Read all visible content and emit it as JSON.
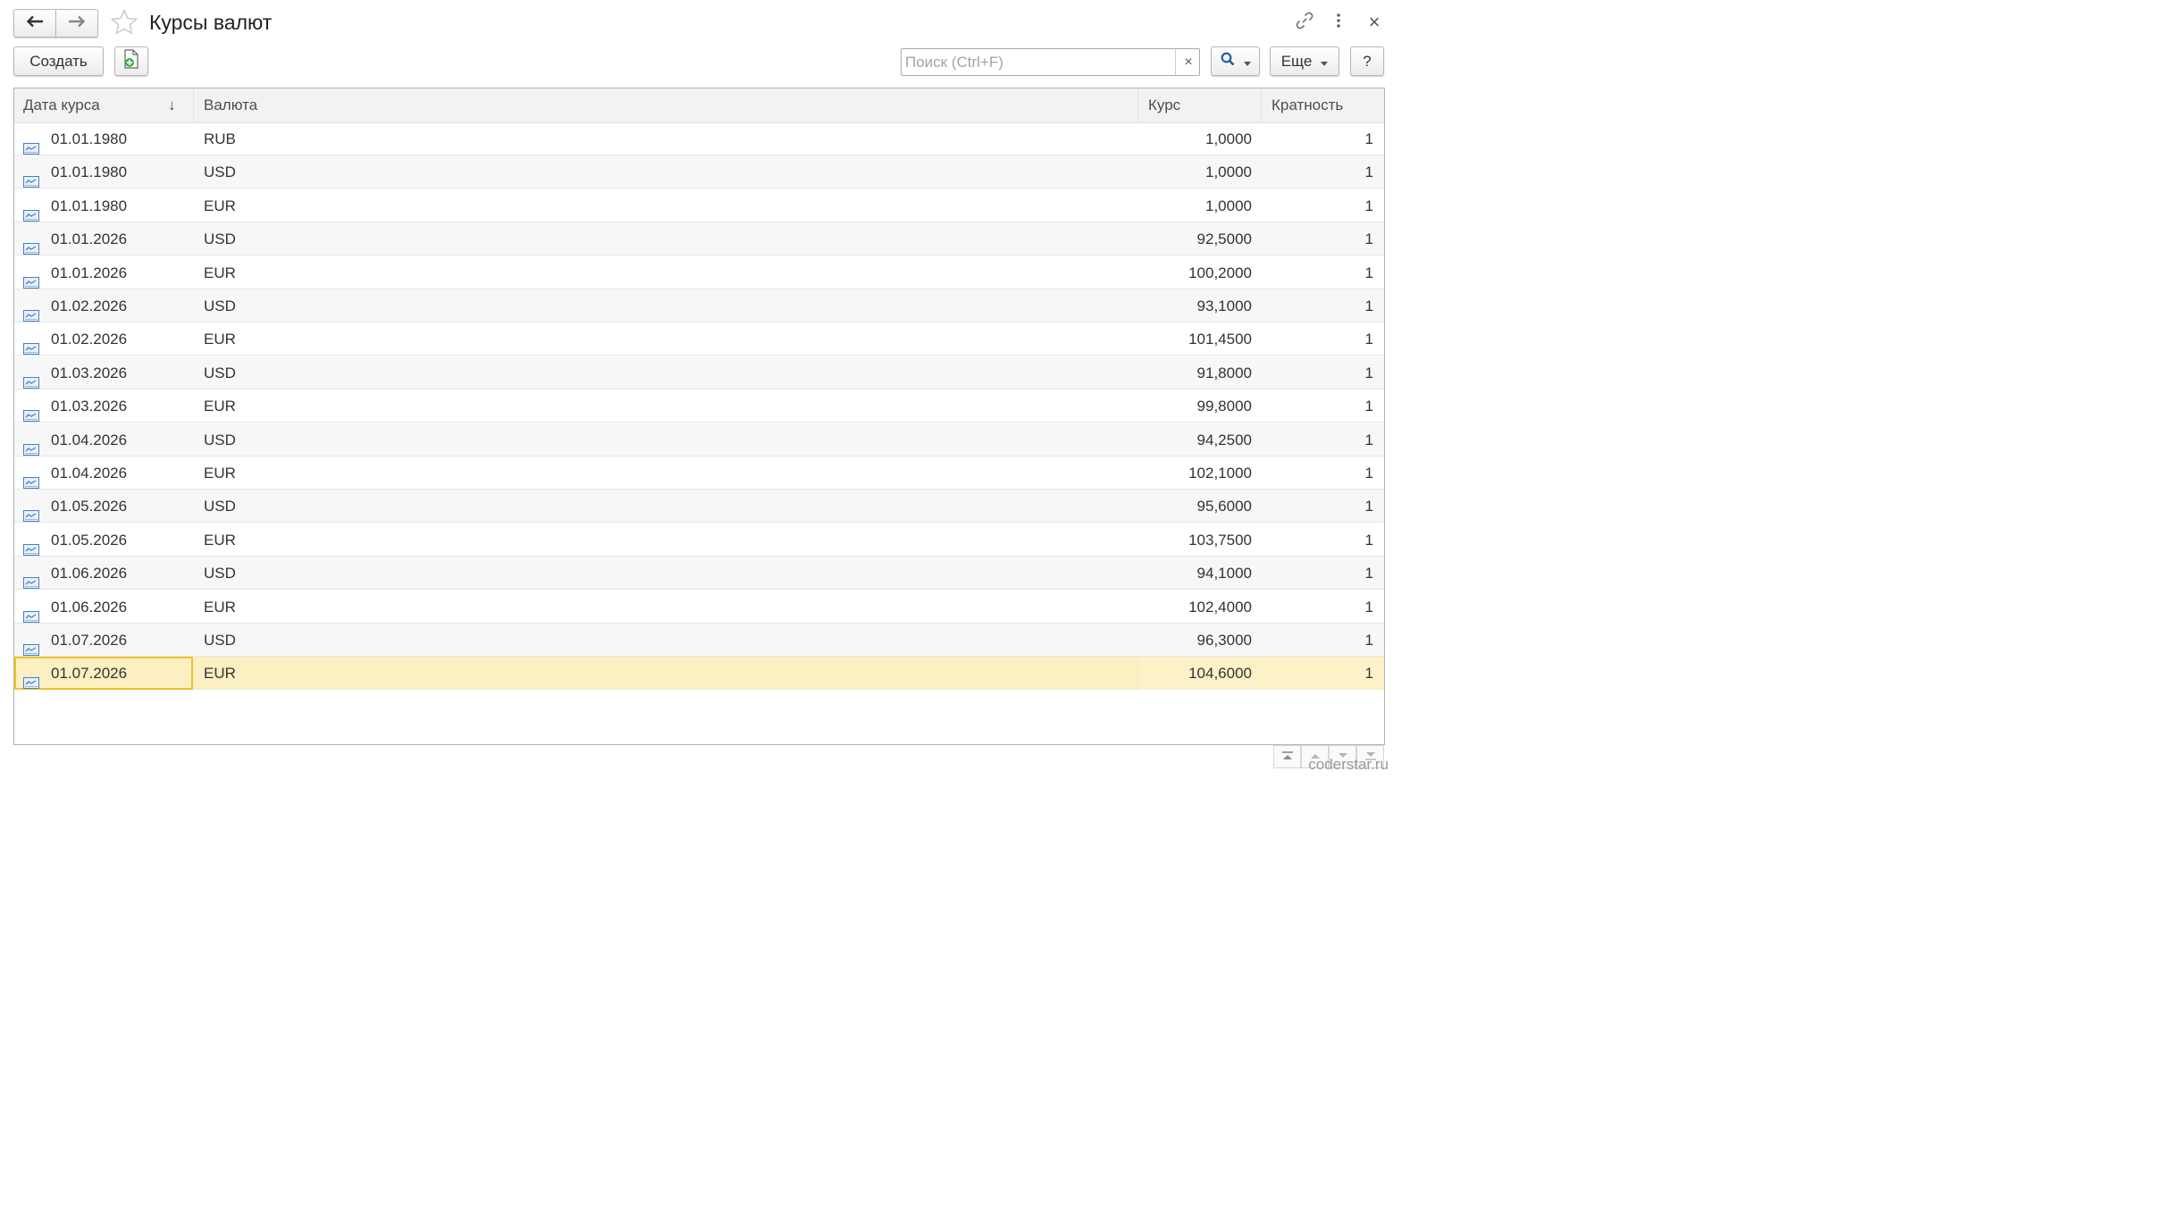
{
  "window": {
    "title": "Курсы валют",
    "back_icon": "arrow-left-icon",
    "forward_icon": "arrow-right-icon",
    "favorite_icon": "star-icon",
    "link_icon": "link-icon",
    "menu_icon": "more-vertical-icon",
    "close_icon": "close-icon",
    "close_symbol": "×"
  },
  "toolbar": {
    "create_label": "Создать",
    "add_file_icon": "add-document-icon",
    "search_placeholder": "Поиск (Ctrl+F)",
    "search_value": "",
    "clear_symbol": "×",
    "search_icon": "magnifier-icon",
    "more_label": "Еще",
    "help_label": "?"
  },
  "table": {
    "columns": {
      "date": "Дата курса",
      "currency": "Валюта",
      "rate": "Курс",
      "multiplicity": "Кратность"
    },
    "sort_indicator": "↓",
    "row_icon": "rate-record-icon",
    "selected_row": 16,
    "rows": [
      {
        "date": "01.01.1980",
        "currency": "RUB",
        "rate": "1,0000",
        "multiplicity": "1"
      },
      {
        "date": "01.01.1980",
        "currency": "USD",
        "rate": "1,0000",
        "multiplicity": "1"
      },
      {
        "date": "01.01.1980",
        "currency": "EUR",
        "rate": "1,0000",
        "multiplicity": "1"
      },
      {
        "date": "01.01.2026",
        "currency": "USD",
        "rate": "92,5000",
        "multiplicity": "1"
      },
      {
        "date": "01.01.2026",
        "currency": "EUR",
        "rate": "100,2000",
        "multiplicity": "1"
      },
      {
        "date": "01.02.2026",
        "currency": "USD",
        "rate": "93,1000",
        "multiplicity": "1"
      },
      {
        "date": "01.02.2026",
        "currency": "EUR",
        "rate": "101,4500",
        "multiplicity": "1"
      },
      {
        "date": "01.03.2026",
        "currency": "USD",
        "rate": "91,8000",
        "multiplicity": "1"
      },
      {
        "date": "01.03.2026",
        "currency": "EUR",
        "rate": "99,8000",
        "multiplicity": "1"
      },
      {
        "date": "01.04.2026",
        "currency": "USD",
        "rate": "94,2500",
        "multiplicity": "1"
      },
      {
        "date": "01.04.2026",
        "currency": "EUR",
        "rate": "102,1000",
        "multiplicity": "1"
      },
      {
        "date": "01.05.2026",
        "currency": "USD",
        "rate": "95,6000",
        "multiplicity": "1"
      },
      {
        "date": "01.05.2026",
        "currency": "EUR",
        "rate": "103,7500",
        "multiplicity": "1"
      },
      {
        "date": "01.06.2026",
        "currency": "USD",
        "rate": "94,1000",
        "multiplicity": "1"
      },
      {
        "date": "01.06.2026",
        "currency": "EUR",
        "rate": "102,4000",
        "multiplicity": "1"
      },
      {
        "date": "01.07.2026",
        "currency": "USD",
        "rate": "96,3000",
        "multiplicity": "1"
      },
      {
        "date": "01.07.2026",
        "currency": "EUR",
        "rate": "104,6000",
        "multiplicity": "1"
      }
    ]
  },
  "navigation": {
    "first_icon": "scroll-to-start-icon",
    "prev_icon": "page-up-icon",
    "next_icon": "page-down-icon",
    "last_icon": "scroll-to-end-icon"
  },
  "watermark": "coderstar.ru",
  "colors": {
    "selected_row": "#fcefc1",
    "selected_border": "#ebc22e",
    "header_bg": "#f2f2f2",
    "alt_row": "#f7f7f7"
  }
}
